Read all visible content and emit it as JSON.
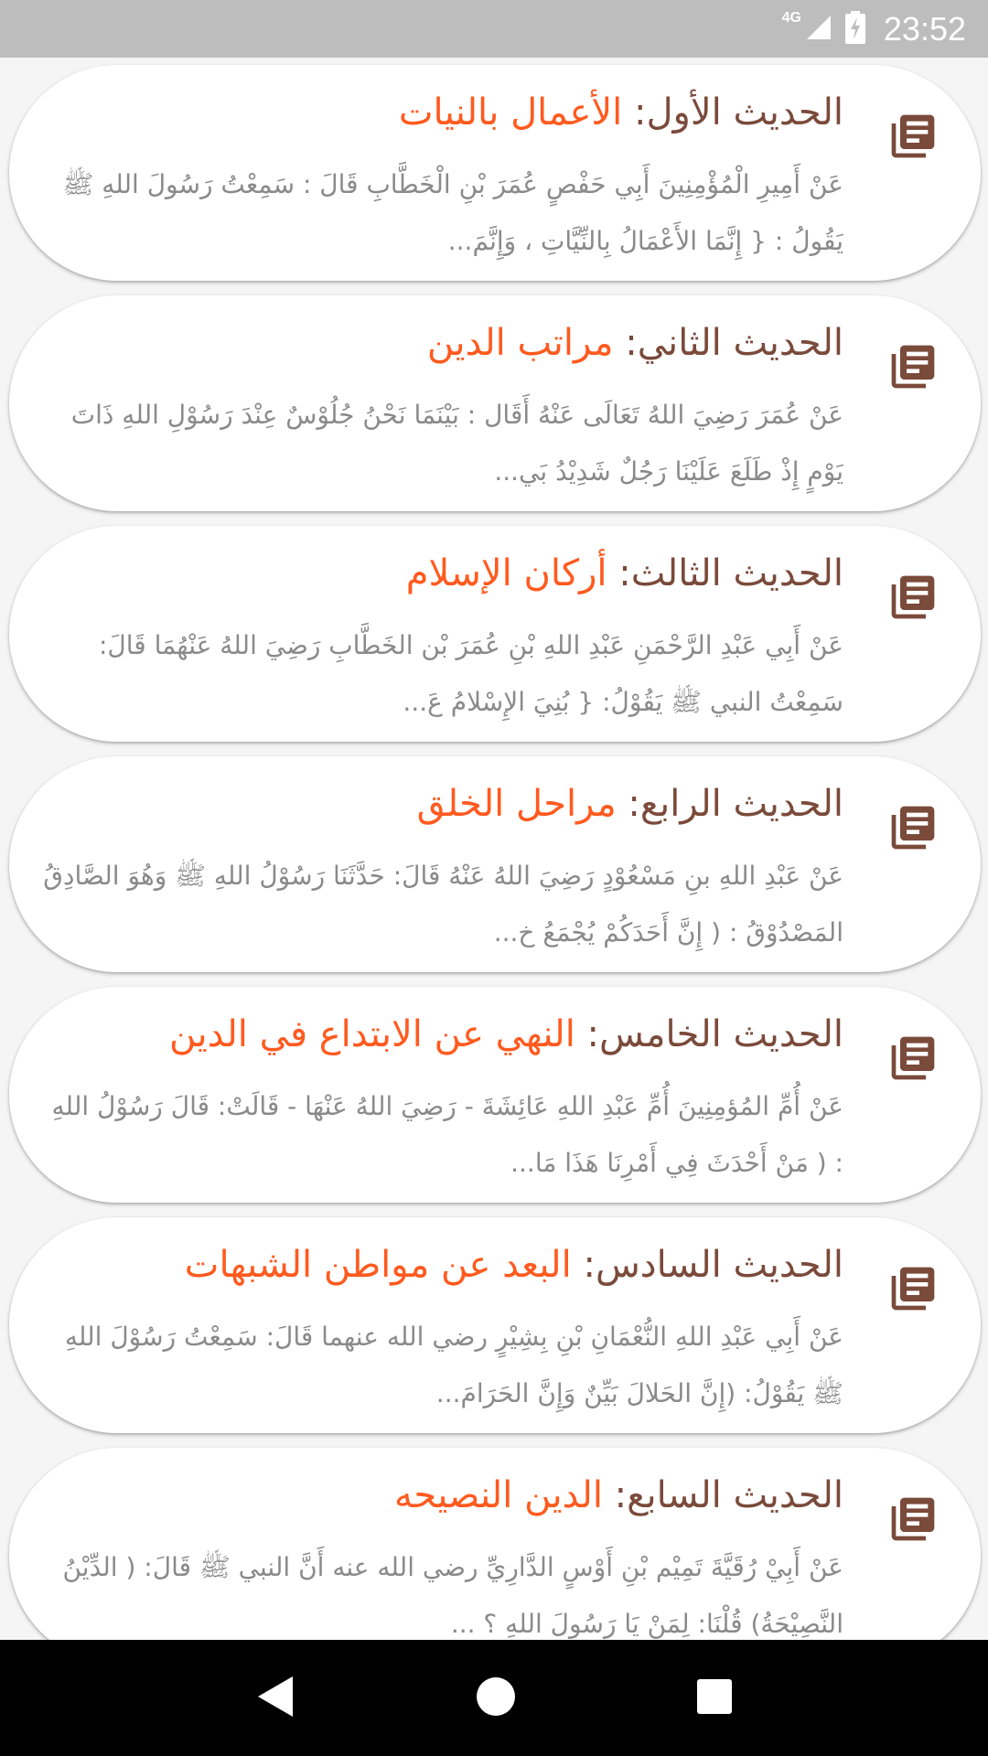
{
  "status_bar": {
    "network": "4G",
    "time": "23:52"
  },
  "hadith_list": [
    {
      "label": "الحديث الأول",
      "subject": "الأعمال بالنيات",
      "excerpt": "عَنْ أَمِيرِ الْمُؤْمِنِينَ أَبِي حَفْصٍ عُمَرَ بْنِ الْخَطَّابِ قَالَ : سَمِعْتُ رَسُولَ اللهِ ﷺ يَقُولُ : { إِنَّمَا الأَعْمَالُ بِالنِّيَّاتِ ، وَإِنَّمَ..."
    },
    {
      "label": "الحديث الثاني",
      "subject": "مراتب الدين",
      "excerpt": "عَنْ عُمَرَ رَضِيَ اللهُ تَعَالَى عَنْهُ أَقَال : بَيْنَمَا نَحْنُ جُلُوْسٌ عِنْدَ رَسُوْلِ اللهِ ذَاتَ يَوْمٍ إِذْ طَلَعَ عَلَيْنَا رَجُلٌ شَدِيْدُ بَي..."
    },
    {
      "label": "الحديث الثالث",
      "subject": "أركان الإسلام",
      "excerpt": "عَنْ أَبِي عَبْدِ الرَّحْمَنِ عَبْدِ اللهِ بْنِ عُمَرَ بْن الخَطَّابِ رَضِيَ اللهُ عَنْهُمَا قَالَ: سَمِعْتُ النبي ﷺ يَقُوْلُ: { بُنِيَ الإِسْلامُ عَ..."
    },
    {
      "label": "الحديث الرابع",
      "subject": "مراحل الخلق",
      "excerpt": "عَنْ عَبْدِ اللهِ بنِ مَسْعُوْدٍ رَضِيَ اللهُ عَنْهُ قَالَ: حَدَّثَنَا رَسُوْلُ اللهِ ﷺ وَهُوَ الصَّادِقُ المَصْدُوْقُ : ( إِنَّ أَحَدَكُمْ يُجْمَعُ خ..."
    },
    {
      "label": "الحديث الخامس",
      "subject": "النهي عن الابتداع في الدين",
      "excerpt": "عَنْ أُمِّ المُؤمِنِينَ أُمِّ عَبْدِ اللهِ عَائِشَةَ - رَضِيَ اللهُ عَنْهَا - قَالَتْ: قَالَ رَسُوْلُ اللهِ : ( مَنْ أَحْدَثَ فِي أَمْرِنَا هَذَا مَا..."
    },
    {
      "label": "الحديث السادس",
      "subject": "البعد عن مواطن الشبهات",
      "excerpt": "عَنْ أَبِي عَبْدِ اللهِ النُّعْمَانِ بْنِ بِشِيْرٍ رضي الله عنهما قَالَ: سَمِعْتُ رَسُوْلَ اللهِ ﷺ يَقُوْلُ: (إِنَّ الحَلالَ بَيِّنٌ وَإِنَّ الحَرَامَ..."
    },
    {
      "label": "الحديث السابع",
      "subject": "الدين النصيحه",
      "excerpt": "عَنْ أَبِيْ رُقَيَّةَ تَمِيْم بْنِ أَوْسٍ الدَّارِيِّ رضي الله عنه أَنَّ النبي ﷺ قَالَ: ( الدِّيْنُ النَّصِيْحَةُ) قُلْنَا: لِمَنْ يَا رَسُولَ اللهِ ؟ ..."
    }
  ],
  "colors": {
    "label": "#7a4a3a",
    "subject": "#ff5a1f",
    "excerpt": "#8a8a8a",
    "icon": "#7a4a3a"
  },
  "icons": {
    "card": "library-books-icon",
    "nav_back": "back-triangle-icon",
    "nav_home": "home-circle-icon",
    "nav_recents": "recents-square-icon"
  }
}
